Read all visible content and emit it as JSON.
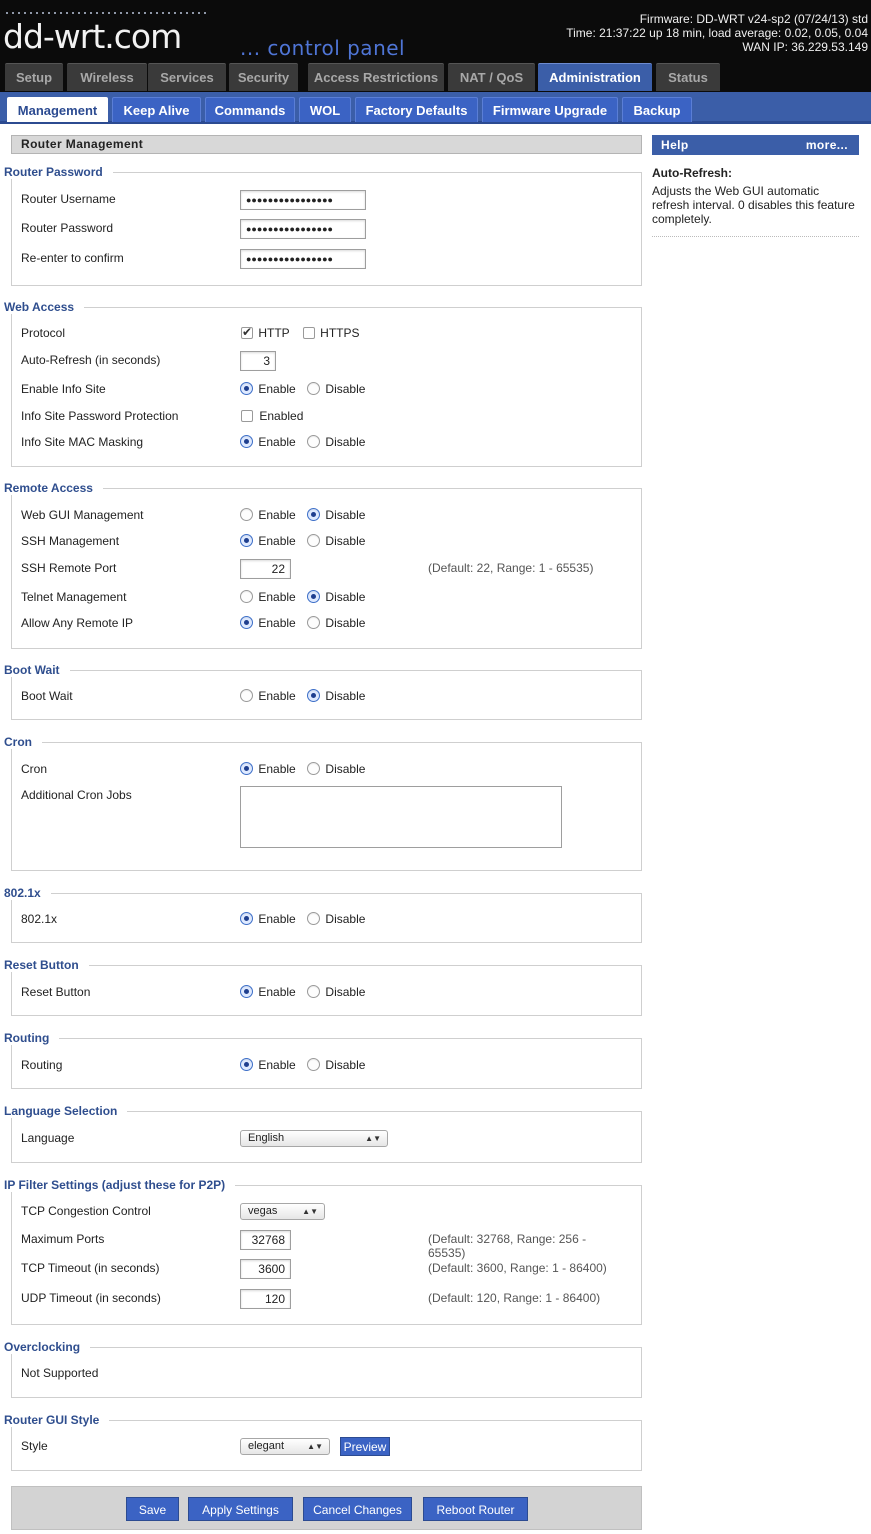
{
  "header": {
    "logo_text": "dd-wrt.com",
    "subtitle": "... control panel",
    "firmware": "Firmware: DD-WRT v24-sp2 (07/24/13) std",
    "time": "Time: 21:37:22 up 18 min, load average: 0.02, 0.05, 0.04",
    "wan_ip": "WAN IP: 36.229.53.149"
  },
  "main_tabs": [
    "Setup",
    "Wireless",
    "Services",
    "Security",
    "Access Restrictions",
    "NAT / QoS",
    "Administration",
    "Status"
  ],
  "sub_tabs": [
    "Management",
    "Keep Alive",
    "Commands",
    "WOL",
    "Factory Defaults",
    "Firmware Upgrade",
    "Backup"
  ],
  "page_title": "Router Management",
  "common": {
    "enable": "Enable",
    "disable": "Disable"
  },
  "router_password": {
    "title": "Router Password",
    "username_label": "Router Username",
    "password_label": "Router Password",
    "confirm_label": "Re-enter to confirm",
    "masked": "●●●●●●●●●●●●●●●●"
  },
  "web_access": {
    "title": "Web Access",
    "protocol_label": "Protocol",
    "http": "HTTP",
    "https": "HTTPS",
    "autorefresh_label": "Auto-Refresh (in seconds)",
    "autorefresh_value": "3",
    "info_site_label": "Enable Info Site",
    "info_pwd_label": "Info Site Password Protection",
    "enabled": "Enabled",
    "mac_mask_label": "Info Site MAC Masking"
  },
  "remote_access": {
    "title": "Remote Access",
    "webgui_label": "Web GUI Management",
    "ssh_label": "SSH Management",
    "ssh_port_label": "SSH Remote Port",
    "ssh_port_value": "22",
    "ssh_port_note": "(Default: 22, Range: 1 - 65535)",
    "telnet_label": "Telnet Management",
    "any_ip_label": "Allow Any Remote IP"
  },
  "boot_wait": {
    "title": "Boot Wait",
    "label": "Boot Wait"
  },
  "cron": {
    "title": "Cron",
    "label": "Cron",
    "jobs_label": "Additional Cron Jobs"
  },
  "dot1x": {
    "title": "802.1x",
    "label": "802.1x"
  },
  "reset_button": {
    "title": "Reset Button",
    "label": "Reset Button"
  },
  "routing": {
    "title": "Routing",
    "label": "Routing"
  },
  "language": {
    "title": "Language Selection",
    "label": "Language",
    "value": "English"
  },
  "ip_filter": {
    "title": "IP Filter Settings (adjust these for P2P)",
    "tcp_cc_label": "TCP Congestion Control",
    "tcp_cc_value": "vegas",
    "max_ports_label": "Maximum Ports",
    "max_ports_value": "32768",
    "max_ports_note_1": "(Default: 32768, Range: 256 -",
    "max_ports_note_2": "65535)",
    "tcp_timeout_label": "TCP Timeout (in seconds)",
    "tcp_timeout_value": "3600",
    "tcp_timeout_note": "(Default: 3600, Range: 1 - 86400)",
    "udp_timeout_label": "UDP Timeout (in seconds)",
    "udp_timeout_value": "120",
    "udp_timeout_note": "(Default: 120, Range: 1 - 86400)"
  },
  "overclocking": {
    "title": "Overclocking",
    "value": "Not Supported"
  },
  "gui_style": {
    "title": "Router GUI Style",
    "label": "Style",
    "value": "elegant",
    "preview": "Preview"
  },
  "help": {
    "title": "Help",
    "more": "more...",
    "topic": "Auto-Refresh:",
    "body": "Adjusts the Web GUI automatic refresh interval. 0 disables this feature completely."
  },
  "buttons": {
    "save": "Save",
    "apply": "Apply Settings",
    "cancel": "Cancel Changes",
    "reboot": "Reboot Router"
  },
  "colors": {
    "accent": "#3b5ea8",
    "button": "#3b63c4",
    "section_title": "#2f4e8e"
  }
}
